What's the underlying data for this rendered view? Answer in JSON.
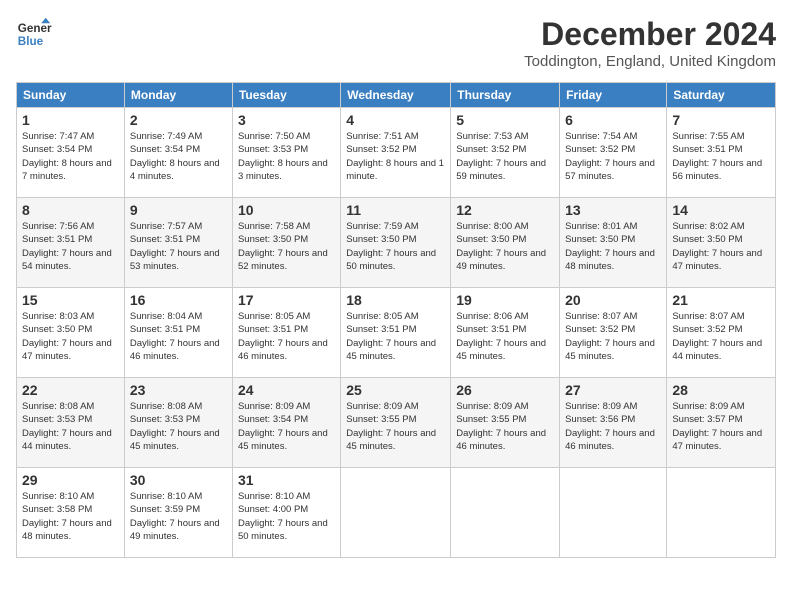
{
  "logo": {
    "line1": "General",
    "line2": "Blue"
  },
  "title": "December 2024",
  "location": "Toddington, England, United Kingdom",
  "days_of_week": [
    "Sunday",
    "Monday",
    "Tuesday",
    "Wednesday",
    "Thursday",
    "Friday",
    "Saturday"
  ],
  "weeks": [
    [
      {
        "day": "1",
        "sunrise": "Sunrise: 7:47 AM",
        "sunset": "Sunset: 3:54 PM",
        "daylight": "Daylight: 8 hours and 7 minutes."
      },
      {
        "day": "2",
        "sunrise": "Sunrise: 7:49 AM",
        "sunset": "Sunset: 3:54 PM",
        "daylight": "Daylight: 8 hours and 4 minutes."
      },
      {
        "day": "3",
        "sunrise": "Sunrise: 7:50 AM",
        "sunset": "Sunset: 3:53 PM",
        "daylight": "Daylight: 8 hours and 3 minutes."
      },
      {
        "day": "4",
        "sunrise": "Sunrise: 7:51 AM",
        "sunset": "Sunset: 3:52 PM",
        "daylight": "Daylight: 8 hours and 1 minute."
      },
      {
        "day": "5",
        "sunrise": "Sunrise: 7:53 AM",
        "sunset": "Sunset: 3:52 PM",
        "daylight": "Daylight: 7 hours and 59 minutes."
      },
      {
        "day": "6",
        "sunrise": "Sunrise: 7:54 AM",
        "sunset": "Sunset: 3:52 PM",
        "daylight": "Daylight: 7 hours and 57 minutes."
      },
      {
        "day": "7",
        "sunrise": "Sunrise: 7:55 AM",
        "sunset": "Sunset: 3:51 PM",
        "daylight": "Daylight: 7 hours and 56 minutes."
      }
    ],
    [
      {
        "day": "8",
        "sunrise": "Sunrise: 7:56 AM",
        "sunset": "Sunset: 3:51 PM",
        "daylight": "Daylight: 7 hours and 54 minutes."
      },
      {
        "day": "9",
        "sunrise": "Sunrise: 7:57 AM",
        "sunset": "Sunset: 3:51 PM",
        "daylight": "Daylight: 7 hours and 53 minutes."
      },
      {
        "day": "10",
        "sunrise": "Sunrise: 7:58 AM",
        "sunset": "Sunset: 3:50 PM",
        "daylight": "Daylight: 7 hours and 52 minutes."
      },
      {
        "day": "11",
        "sunrise": "Sunrise: 7:59 AM",
        "sunset": "Sunset: 3:50 PM",
        "daylight": "Daylight: 7 hours and 50 minutes."
      },
      {
        "day": "12",
        "sunrise": "Sunrise: 8:00 AM",
        "sunset": "Sunset: 3:50 PM",
        "daylight": "Daylight: 7 hours and 49 minutes."
      },
      {
        "day": "13",
        "sunrise": "Sunrise: 8:01 AM",
        "sunset": "Sunset: 3:50 PM",
        "daylight": "Daylight: 7 hours and 48 minutes."
      },
      {
        "day": "14",
        "sunrise": "Sunrise: 8:02 AM",
        "sunset": "Sunset: 3:50 PM",
        "daylight": "Daylight: 7 hours and 47 minutes."
      }
    ],
    [
      {
        "day": "15",
        "sunrise": "Sunrise: 8:03 AM",
        "sunset": "Sunset: 3:50 PM",
        "daylight": "Daylight: 7 hours and 47 minutes."
      },
      {
        "day": "16",
        "sunrise": "Sunrise: 8:04 AM",
        "sunset": "Sunset: 3:51 PM",
        "daylight": "Daylight: 7 hours and 46 minutes."
      },
      {
        "day": "17",
        "sunrise": "Sunrise: 8:05 AM",
        "sunset": "Sunset: 3:51 PM",
        "daylight": "Daylight: 7 hours and 46 minutes."
      },
      {
        "day": "18",
        "sunrise": "Sunrise: 8:05 AM",
        "sunset": "Sunset: 3:51 PM",
        "daylight": "Daylight: 7 hours and 45 minutes."
      },
      {
        "day": "19",
        "sunrise": "Sunrise: 8:06 AM",
        "sunset": "Sunset: 3:51 PM",
        "daylight": "Daylight: 7 hours and 45 minutes."
      },
      {
        "day": "20",
        "sunrise": "Sunrise: 8:07 AM",
        "sunset": "Sunset: 3:52 PM",
        "daylight": "Daylight: 7 hours and 45 minutes."
      },
      {
        "day": "21",
        "sunrise": "Sunrise: 8:07 AM",
        "sunset": "Sunset: 3:52 PM",
        "daylight": "Daylight: 7 hours and 44 minutes."
      }
    ],
    [
      {
        "day": "22",
        "sunrise": "Sunrise: 8:08 AM",
        "sunset": "Sunset: 3:53 PM",
        "daylight": "Daylight: 7 hours and 44 minutes."
      },
      {
        "day": "23",
        "sunrise": "Sunrise: 8:08 AM",
        "sunset": "Sunset: 3:53 PM",
        "daylight": "Daylight: 7 hours and 45 minutes."
      },
      {
        "day": "24",
        "sunrise": "Sunrise: 8:09 AM",
        "sunset": "Sunset: 3:54 PM",
        "daylight": "Daylight: 7 hours and 45 minutes."
      },
      {
        "day": "25",
        "sunrise": "Sunrise: 8:09 AM",
        "sunset": "Sunset: 3:55 PM",
        "daylight": "Daylight: 7 hours and 45 minutes."
      },
      {
        "day": "26",
        "sunrise": "Sunrise: 8:09 AM",
        "sunset": "Sunset: 3:55 PM",
        "daylight": "Daylight: 7 hours and 46 minutes."
      },
      {
        "day": "27",
        "sunrise": "Sunrise: 8:09 AM",
        "sunset": "Sunset: 3:56 PM",
        "daylight": "Daylight: 7 hours and 46 minutes."
      },
      {
        "day": "28",
        "sunrise": "Sunrise: 8:09 AM",
        "sunset": "Sunset: 3:57 PM",
        "daylight": "Daylight: 7 hours and 47 minutes."
      }
    ],
    [
      {
        "day": "29",
        "sunrise": "Sunrise: 8:10 AM",
        "sunset": "Sunset: 3:58 PM",
        "daylight": "Daylight: 7 hours and 48 minutes."
      },
      {
        "day": "30",
        "sunrise": "Sunrise: 8:10 AM",
        "sunset": "Sunset: 3:59 PM",
        "daylight": "Daylight: 7 hours and 49 minutes."
      },
      {
        "day": "31",
        "sunrise": "Sunrise: 8:10 AM",
        "sunset": "Sunset: 4:00 PM",
        "daylight": "Daylight: 7 hours and 50 minutes."
      },
      null,
      null,
      null,
      null
    ]
  ]
}
